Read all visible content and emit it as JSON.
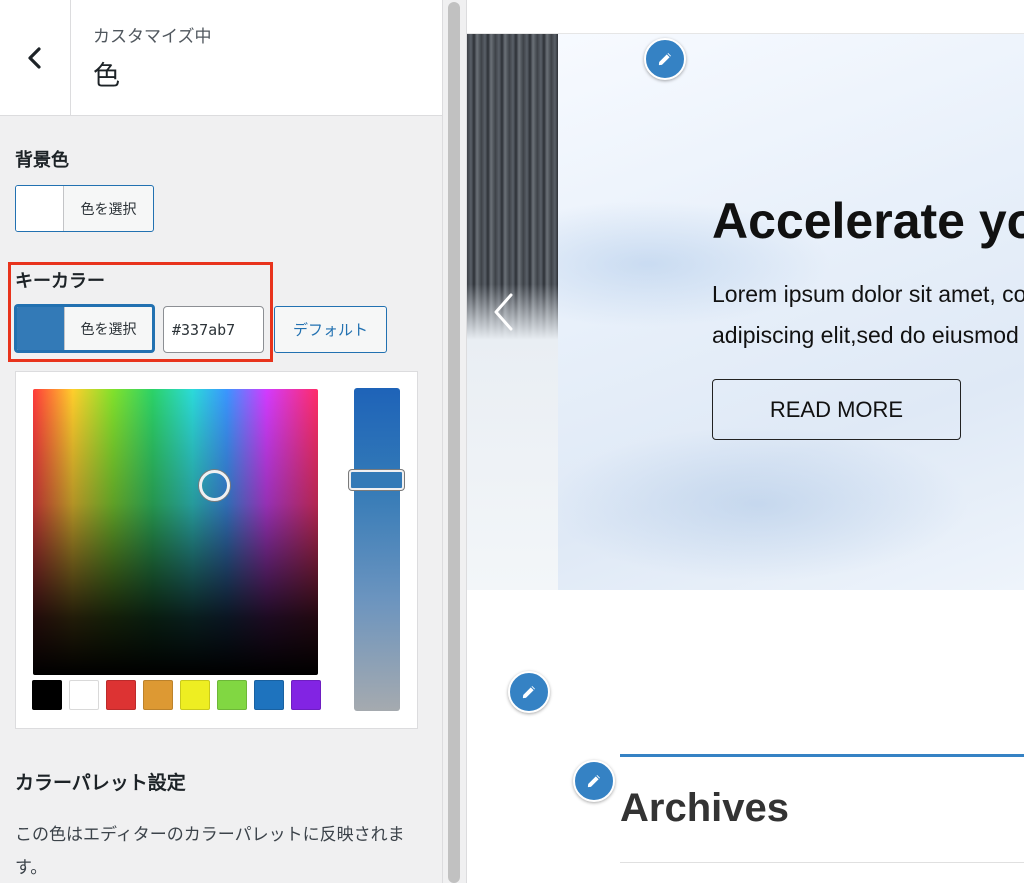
{
  "panel": {
    "header": {
      "subtitle": "カスタマイズ中",
      "title": "色",
      "back_icon": "chevron-left-icon"
    },
    "background_color": {
      "label": "背景色",
      "button_label": "色を選択",
      "value_color": "#ffffff"
    },
    "key_color": {
      "label": "キーカラー",
      "button_label": "色を選択",
      "hex_value": "#337ab7",
      "default_label": "デフォルト",
      "value_color": "#337ab7"
    },
    "picker": {
      "palette": [
        "#000000",
        "#ffffff",
        "#dd3333",
        "#dd9933",
        "#eeee22",
        "#81d742",
        "#1e73be",
        "#8224e3"
      ],
      "strength_level": 0.27
    },
    "palette_settings": {
      "heading": "カラーパレット設定",
      "description": "この色はエディターのカラーパレットに反映されます。"
    }
  },
  "preview": {
    "hero": {
      "title": "Accelerate your",
      "body": "Lorem ipsum dolor sit amet, consectetur adipiscing elit,sed do eiusmod",
      "button_label": "READ MORE",
      "prev_icon": "chevron-left-icon"
    },
    "archives": {
      "title": "Archives"
    },
    "edit_icon": "pencil-icon"
  },
  "colors": {
    "accent": "#2271b1",
    "highlight": "#e8331c",
    "edit_pencil": "#3582c4"
  }
}
